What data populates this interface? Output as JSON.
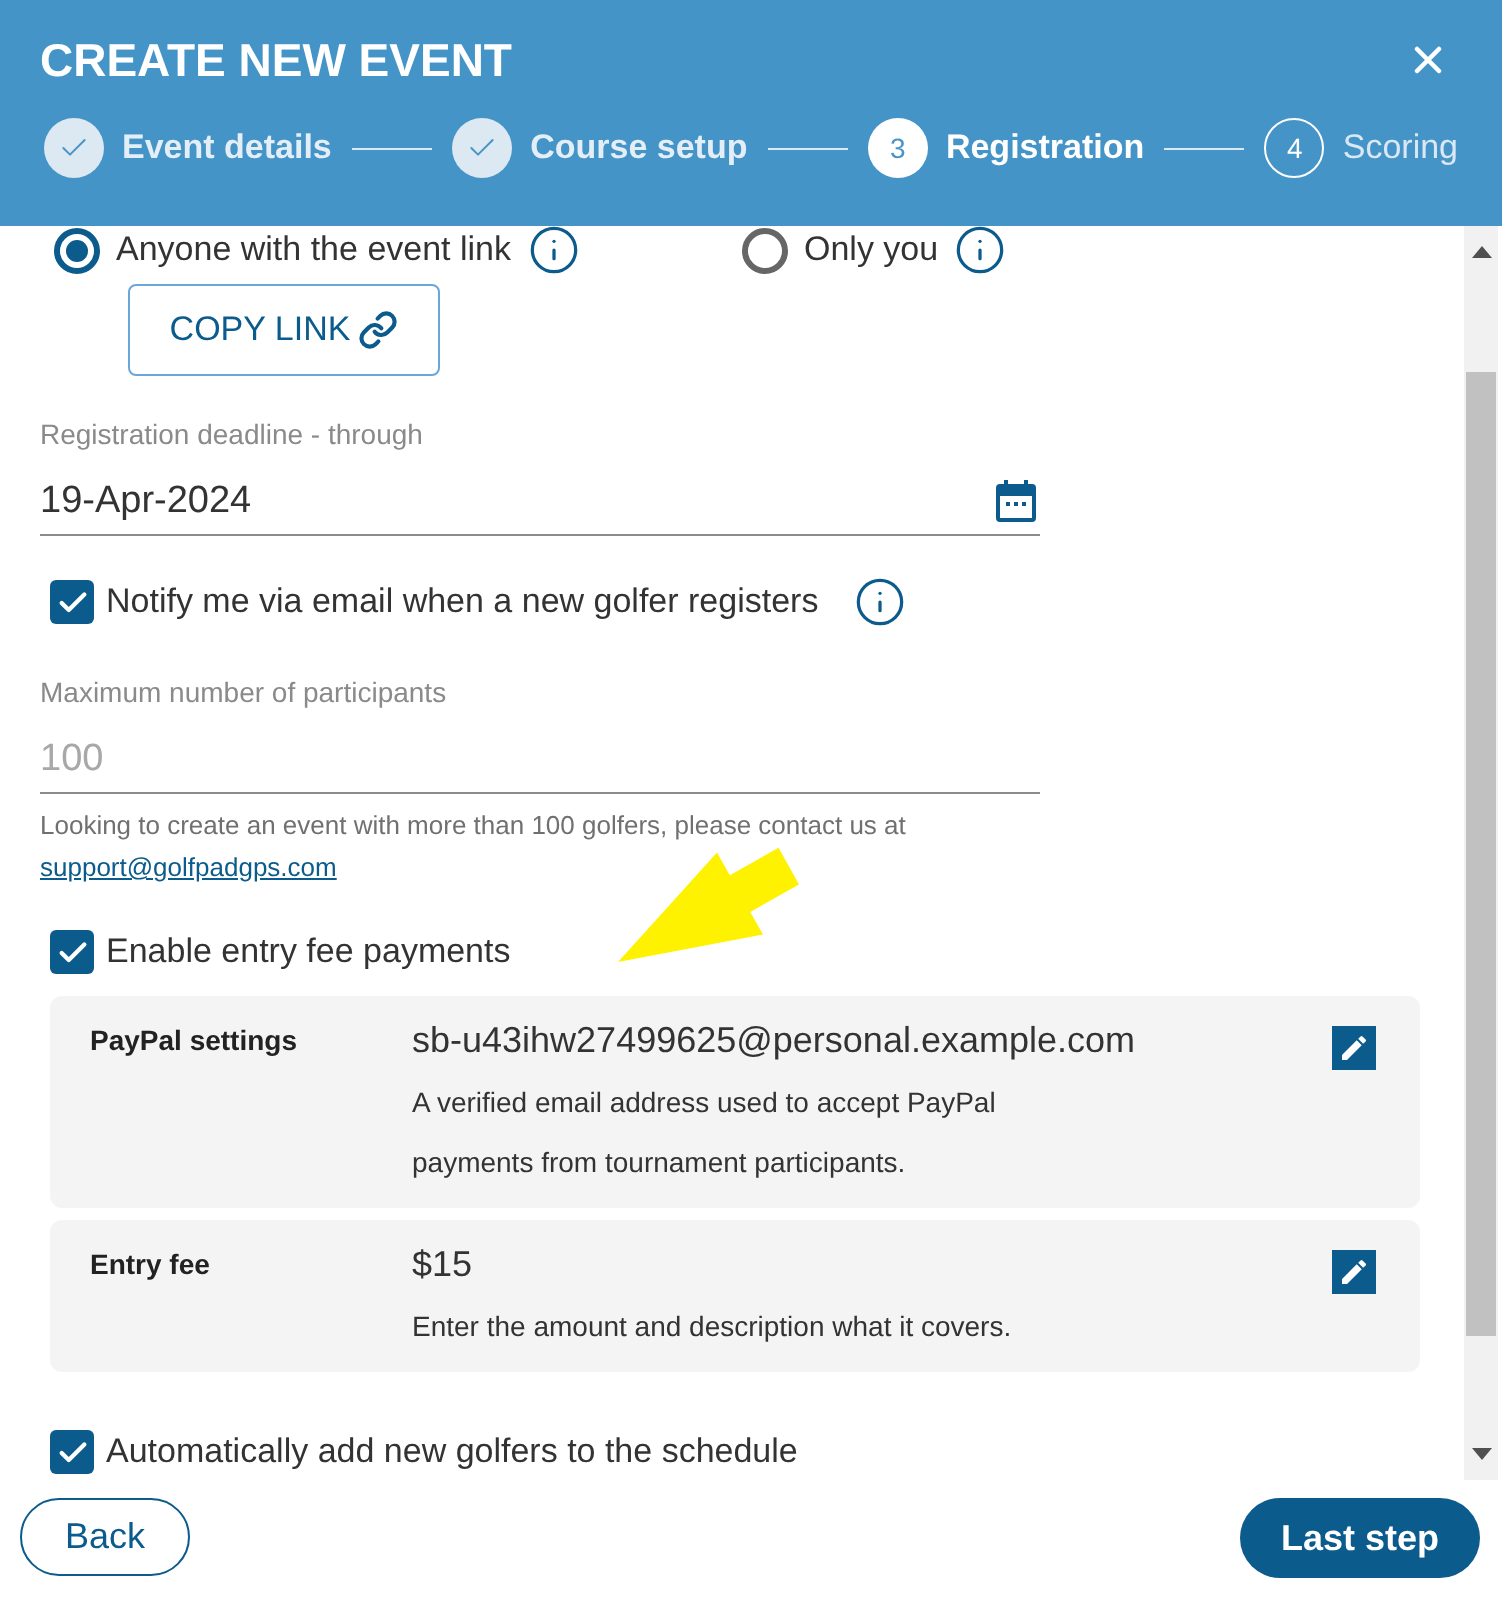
{
  "dialog": {
    "title": "CREATE NEW EVENT"
  },
  "steps": [
    {
      "label": "Event details",
      "completed": true,
      "selected": false
    },
    {
      "label": "Course setup",
      "completed": true,
      "selected": false
    },
    {
      "label": "Registration",
      "number": "3",
      "completed": false,
      "selected": true
    },
    {
      "label": "Scoring",
      "number": "4",
      "completed": false,
      "selected": false
    }
  ],
  "visibility": {
    "options": [
      {
        "label": "Anyone with the event link",
        "selected": true
      },
      {
        "label": "Only you",
        "selected": false
      }
    ],
    "copy_button": "COPY LINK"
  },
  "deadline": {
    "label": "Registration deadline - through",
    "value": "19-Apr-2024"
  },
  "notify": {
    "label": "Notify me via email when a new golfer registers",
    "checked": true
  },
  "participants": {
    "label": "Maximum number of participants",
    "placeholder": "100",
    "hint": "Looking to create an event with more than 100 golfers, please contact us at",
    "hint_link": "support@golfpadgps.com"
  },
  "entry_fee": {
    "label": "Enable entry fee payments",
    "checked": true,
    "settings": [
      {
        "label": "PayPal settings",
        "value": "sb-u43ihw27499625@personal.example.com",
        "description": "A verified email address used to accept PayPal payments from tournament participants."
      },
      {
        "label": "Entry fee",
        "value": "$15",
        "description": "Enter the amount and description what it covers."
      }
    ]
  },
  "auto_add": {
    "label": "Automatically add new golfers to the schedule",
    "checked": true
  },
  "footer": {
    "back_button": "Back",
    "next_button": "Last step"
  }
}
